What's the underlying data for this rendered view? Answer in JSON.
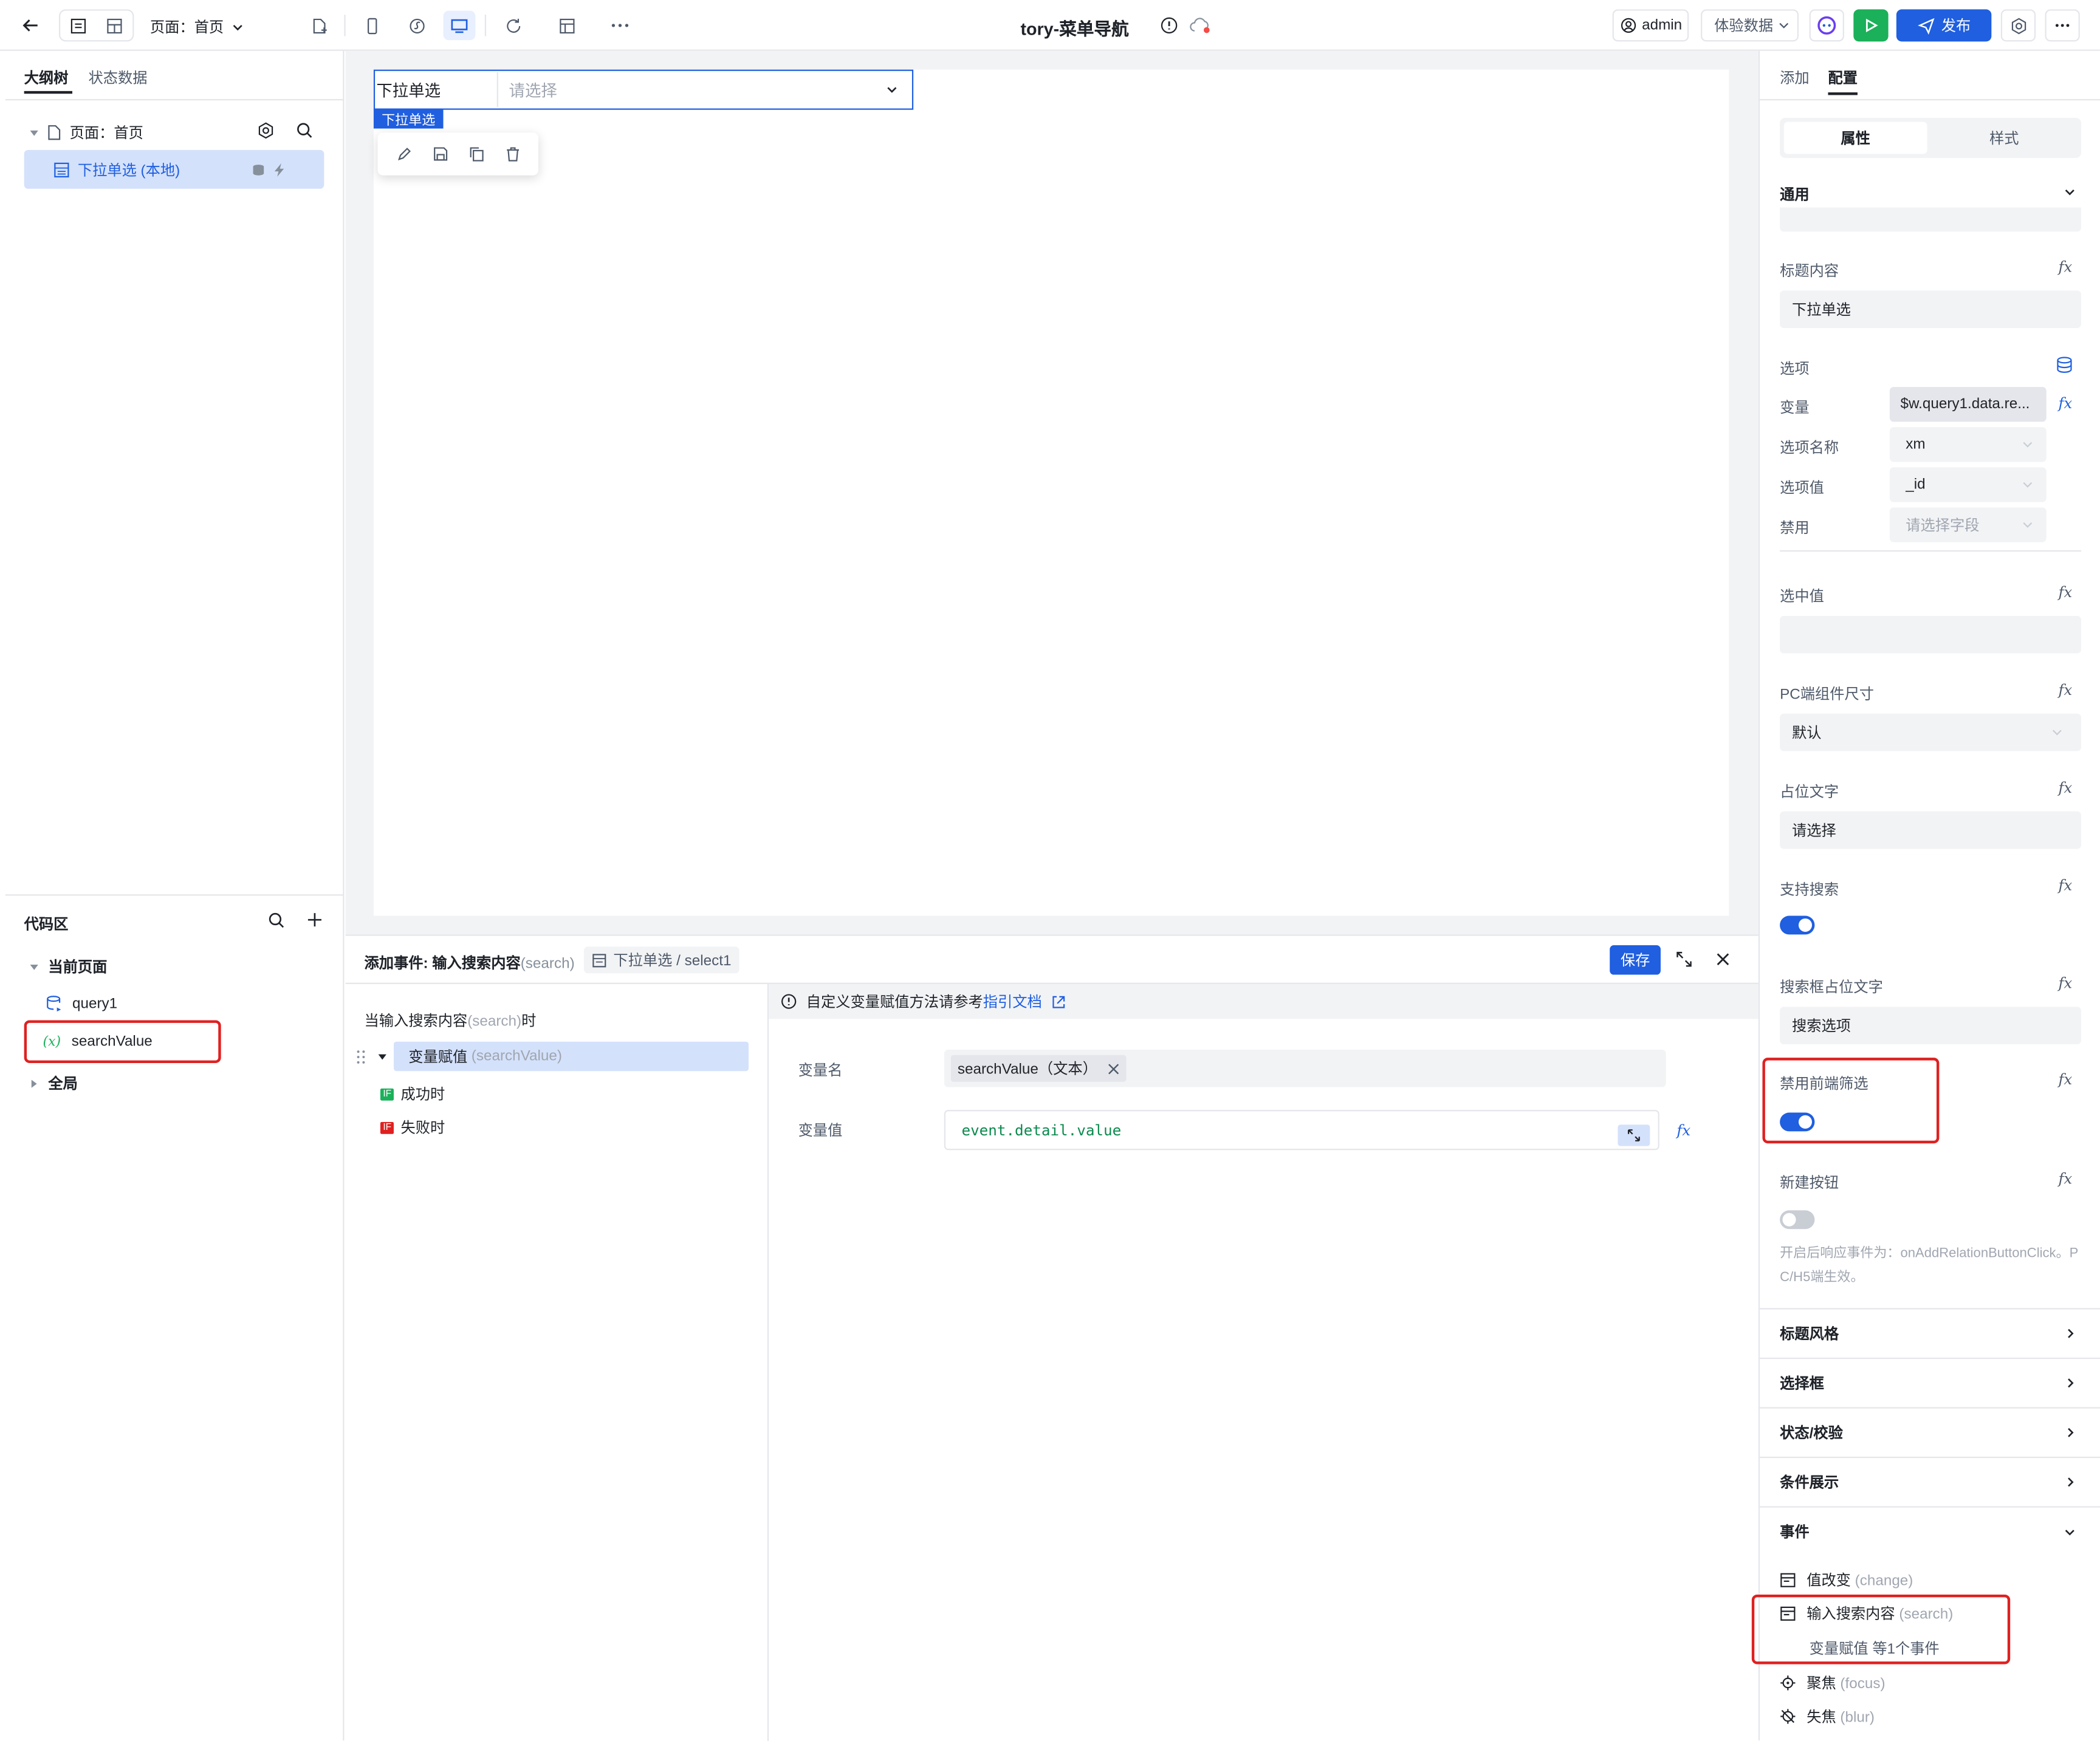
{
  "topbar": {
    "page_label": "页面：首页",
    "app_title": "tory-菜单导航",
    "user": "admin",
    "env_select": "体验数据",
    "publish": "发布"
  },
  "left": {
    "tabs": [
      "大纲树",
      "状态数据"
    ],
    "tree_page": "页面：首页",
    "tree_component": "下拉单选 (本地)",
    "code_title": "代码区",
    "code_current": "当前页面",
    "code_items": [
      "query1",
      "searchValue"
    ],
    "code_var_prefix": "(x)",
    "code_global": "全局"
  },
  "canvas": {
    "select_label": "下拉单选",
    "select_placeholder": "请选择",
    "select_tag": "下拉单选"
  },
  "event": {
    "title": "添加事件: 输入搜索内容",
    "title_sub": "(search)",
    "breadcrumb": "下拉单选 / select1",
    "save": "保存",
    "trigger_label": "当输入搜索内容",
    "trigger_sub": "(search)",
    "trigger_suffix": "时",
    "action": "变量赋值",
    "action_sub": "(searchValue)",
    "success": "成功时",
    "fail": "失败时",
    "if_badge": "IF",
    "tip": "自定义变量赋值方法请参考",
    "tip_link": "指引文档",
    "var_name_label": "变量名",
    "var_name_tag": "searchValue（文本）",
    "var_value_label": "变量值",
    "var_value": "event.detail.value"
  },
  "right": {
    "tabs": [
      "添加",
      "配置"
    ],
    "seg": [
      "属性",
      "样式"
    ],
    "general": "通用",
    "title_content_label": "标题内容",
    "title_content": "下拉单选",
    "options_label": "选项",
    "var_label": "变量",
    "var_value": "$w.query1.data.re...",
    "opt_name_label": "选项名称",
    "opt_name": "xm",
    "opt_value_label": "选项值",
    "opt_value": "_id",
    "disabled_label": "禁用",
    "disabled_placeholder": "请选择字段",
    "selected_label": "选中值",
    "pc_size_label": "PC端组件尺寸",
    "pc_size": "默认",
    "placeholder_label": "占位文字",
    "placeholder": "请选择",
    "support_search_label": "支持搜索",
    "search_ph_label": "搜索框占位文字",
    "search_ph": "搜索选项",
    "disable_filter_label": "禁用前端筛选",
    "new_button_label": "新建按钮",
    "new_button_help": "开启后响应事件为：onAddRelationButtonClick。PC/H5端生效。",
    "sections": [
      "标题风格",
      "选择框",
      "状态/校验",
      "条件展示",
      "事件"
    ],
    "events": [
      {
        "label": "值改变",
        "sub": "(change)"
      },
      {
        "label": "输入搜索内容",
        "sub": "(search)"
      },
      {
        "label": "聚焦",
        "sub": "(focus)"
      },
      {
        "label": "失焦",
        "sub": "(blur)"
      }
    ],
    "event_summary": "变量赋值 等1个事件",
    "fx": "fx",
    "support_search_on": true,
    "disable_filter_on": true,
    "new_button_on": false
  },
  "colors": {
    "accent": "#1f5fe0",
    "highlight": "#e02020",
    "publish_green": "#1bb05a"
  }
}
